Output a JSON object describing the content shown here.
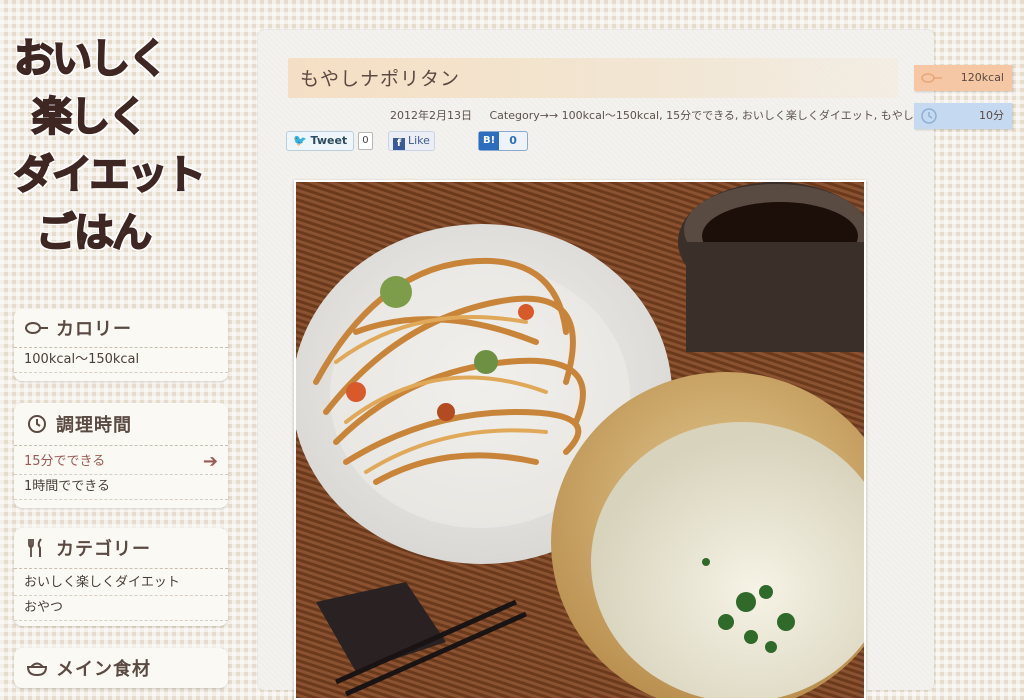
{
  "logo": {
    "lines": [
      "おいしく",
      "楽しく",
      "ダイエット",
      "ごはん"
    ]
  },
  "sidebar": {
    "calorie": {
      "title": "カロリー",
      "icon": "scale-icon",
      "items": [
        "100kcal〜150kcal"
      ]
    },
    "time": {
      "title": "調理時間",
      "icon": "clock-icon",
      "items": [
        "15分でできる",
        "1時間でできる"
      ],
      "active_index": 0
    },
    "category": {
      "title": "カテゴリー",
      "icon": "fork-knife-icon",
      "items": [
        "おいしく楽しくダイエット",
        "おやつ"
      ]
    },
    "main_ingredient": {
      "title": "メイン食材",
      "icon": "bowl-icon"
    }
  },
  "post": {
    "title": "もやしナポリタン",
    "date": "2012年2月13日",
    "category_line": "Category→→ 100kcal〜150kcal, 15分でできる, おいしく楽しくダイエット, もやし"
  },
  "social": {
    "tweet_label": "Tweet",
    "tweet_count": "0",
    "like_label": "Like",
    "hatena_label": "B!",
    "hatena_count": "0"
  },
  "tags": {
    "calorie": "120kcal",
    "time": "10分"
  },
  "colors": {
    "accent": "#9b5a53",
    "calorie_tag": "#f6c7a4",
    "time_tag": "#c5daf0"
  }
}
